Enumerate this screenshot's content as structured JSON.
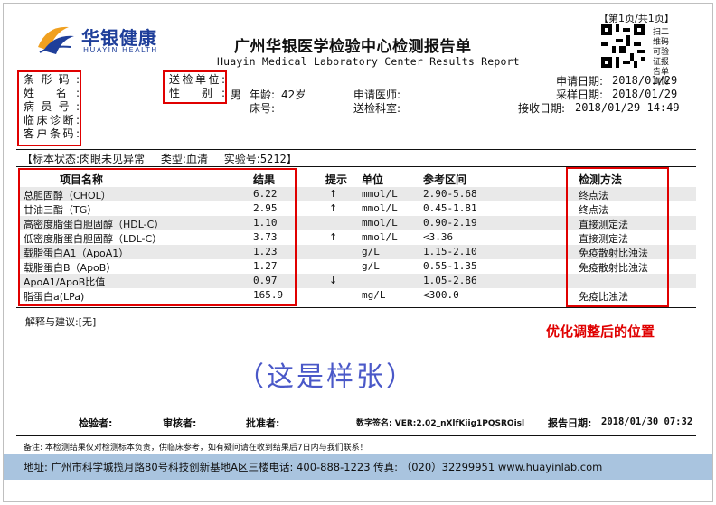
{
  "header": {
    "logo_text": "华银健康",
    "logo_sub": "HUAYIN HEALTH",
    "title": "广州华银医学检验中心检测报告单",
    "subtitle": "Huayin Medical Laboratory Center Results Report",
    "page_indicator": "【第1页/共1页】",
    "qr_note": "扫二维码可验证报告单真伪"
  },
  "patient": {
    "barcode_label": "条形码:",
    "name_label": "姓  名:",
    "patient_no_label": "病员号:",
    "diagnosis_label": "临床诊断:",
    "customer_barcode_label": "客户条码:",
    "unit_label": "送检单位:",
    "sex_label": "性  别:",
    "sex_value": "男",
    "age_label": "年龄:",
    "age_value": "42岁",
    "bed_label": "床号:",
    "doctor_label": "申请医师:",
    "dept_label": "送检科室:",
    "apply_date_label": "申请日期:",
    "apply_date": "2018/01/29",
    "collect_date_label": "采样日期:",
    "collect_date": "2018/01/29",
    "receive_date_label": "接收日期:",
    "receive_date": "2018/01/29 14:49"
  },
  "specimen": {
    "status_label": "【标本状态:",
    "status_value": "肉眼未见异常",
    "type_label": "类型:",
    "type_value": "血清",
    "lab_no_label": "实验号:",
    "lab_no_value": "5212】"
  },
  "table": {
    "headers": {
      "item": "项目名称",
      "result": "结果",
      "flag": "提示",
      "unit": "单位",
      "range": "参考区间",
      "method": "检测方法"
    },
    "rows": [
      {
        "item": "总胆固醇（CHOL）",
        "result": "6.22",
        "flag": "↑",
        "unit": "mmol/L",
        "range": "2.90-5.68",
        "method": "终点法"
      },
      {
        "item": "甘油三酯（TG）",
        "result": "2.95",
        "flag": "↑",
        "unit": "mmol/L",
        "range": "0.45-1.81",
        "method": "终点法"
      },
      {
        "item": "高密度脂蛋白胆固醇（HDL-C）",
        "result": "1.10",
        "flag": "",
        "unit": "mmol/L",
        "range": "0.90-2.19",
        "method": "直接测定法"
      },
      {
        "item": "低密度脂蛋白胆固醇（LDL-C）",
        "result": "3.73",
        "flag": "↑",
        "unit": "mmol/L",
        "range": "<3.36",
        "method": "直接测定法"
      },
      {
        "item": "载脂蛋白A1（ApoA1）",
        "result": "1.23",
        "flag": "",
        "unit": "g/L",
        "range": "1.15-2.10",
        "method": "免疫散射比浊法"
      },
      {
        "item": "载脂蛋白B（ApoB）",
        "result": "1.27",
        "flag": "",
        "unit": "g/L",
        "range": "0.55-1.35",
        "method": "免疫散射比浊法"
      },
      {
        "item": "ApoA1/ApoB比值",
        "result": "0.97",
        "flag": "↓",
        "unit": "",
        "range": "1.05-2.86",
        "method": ""
      },
      {
        "item": "脂蛋白a(LPa)",
        "result": "165.9",
        "flag": "",
        "unit": "mg/L",
        "range": "<300.0",
        "method": "免疫比浊法"
      }
    ]
  },
  "remarks": {
    "advice": "解释与建议:[无]",
    "optimized_note": "优化调整后的位置",
    "sample_mark": "（这是样张）"
  },
  "signatures": {
    "tester": "检验者:",
    "reviewer": "审核者:",
    "approver": "批准者:",
    "digital_signature": "数字签名: VER:2.02_nXlfKiig1PQSROisl",
    "report_date_label": "报告日期:",
    "report_date": "2018/01/30 07:32"
  },
  "footer": {
    "note": "备注: 本检测结果仅对检测标本负责，供临床参考，如有疑问请在收到结果后7日内与我们联系！",
    "address": "地址: 广州市科学城揽月路80号科技创新基地A区三楼电话: 400-888-1223 传真: （020）32299951 www.huayinlab.com"
  },
  "colors": {
    "brand": "#1f3f9a",
    "highlight_box": "#e00000",
    "footer_bar": "#a9c4df",
    "sample_text": "#4a58c8"
  }
}
